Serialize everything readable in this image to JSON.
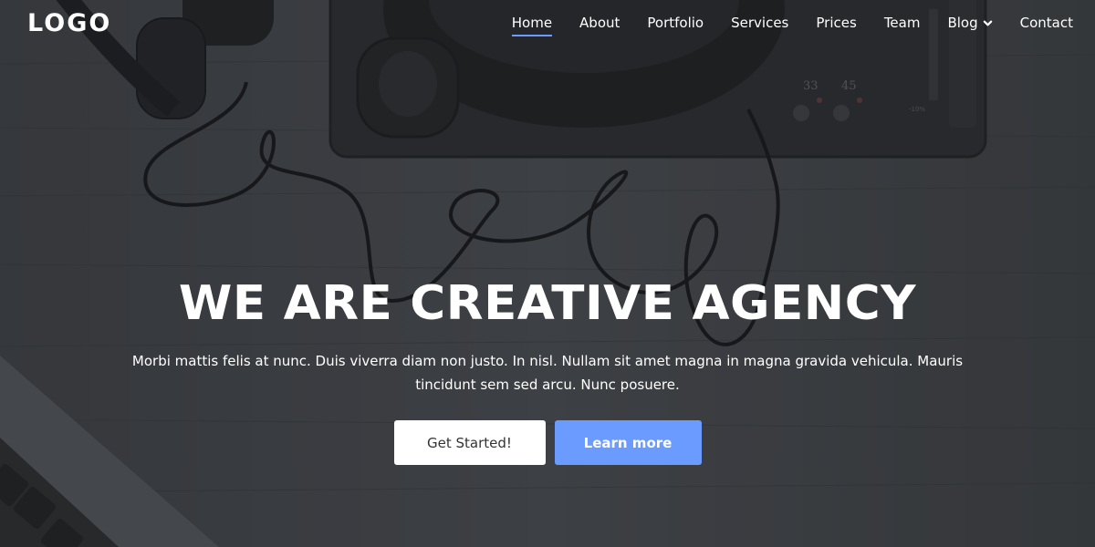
{
  "header": {
    "logo": "LOGO",
    "nav": [
      {
        "label": "Home",
        "active": true
      },
      {
        "label": "About"
      },
      {
        "label": "Portfolio"
      },
      {
        "label": "Services"
      },
      {
        "label": "Prices"
      },
      {
        "label": "Team"
      },
      {
        "label": "Blog",
        "icon": "chevron-down-icon"
      },
      {
        "label": "Contact"
      }
    ]
  },
  "hero": {
    "title": "WE ARE CREATIVE AGENCY",
    "text": "Morbi mattis felis at nunc. Duis viverra diam non justo. In nisl. Nullam sit amet magna in magna gravida vehicula. Mauris tincidunt sem sed arcu. Nunc posuere.",
    "primary_button": "Get Started!",
    "secondary_button": "Learn more",
    "background": {
      "turntable_speed_labels": [
        "33",
        "45"
      ],
      "pitch_label": "-10%"
    }
  },
  "colors": {
    "accent": "#6c9bff",
    "overlay": "#2e2f33",
    "text": "#ffffff",
    "button_light_text": "#333333"
  }
}
